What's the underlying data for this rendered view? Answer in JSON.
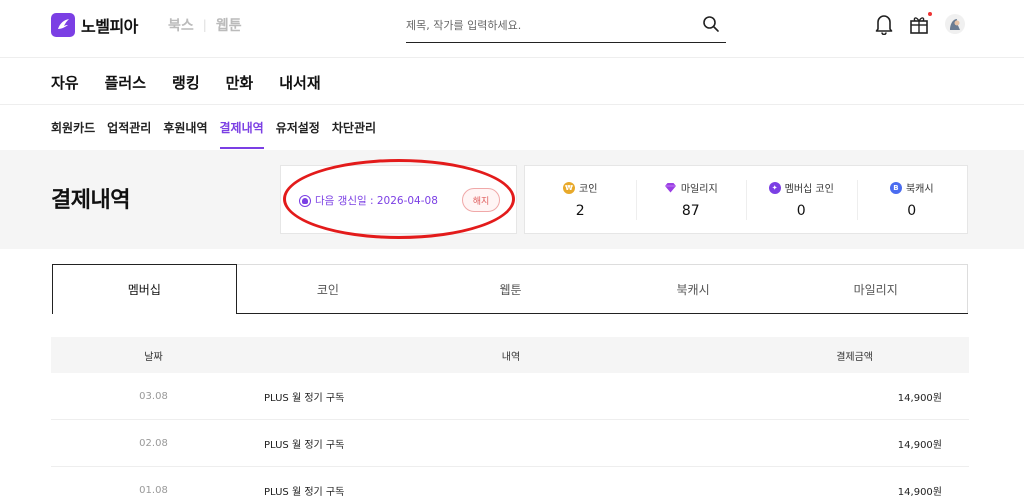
{
  "header": {
    "logo_text": "노벨피아",
    "brands": [
      "북스",
      "웹툰"
    ],
    "search_placeholder": "제목, 작가를 입력하세요."
  },
  "main_nav": [
    "자유",
    "플러스",
    "랭킹",
    "만화",
    "내서재"
  ],
  "sub_nav": {
    "items": [
      "회원카드",
      "업적관리",
      "후원내역",
      "결제내역",
      "유저설정",
      "차단관리"
    ],
    "active_index": 3
  },
  "page_title": "결제내역",
  "membership": {
    "renew_text": "다음 갱신일 : 2026-04-08",
    "cancel_label": "해지"
  },
  "balances": [
    {
      "icon": "coin-icon",
      "label": "코인",
      "value": "2"
    },
    {
      "icon": "gem-icon",
      "label": "마일리지",
      "value": "87"
    },
    {
      "icon": "membership-coin-icon",
      "label": "멤버십 코인",
      "value": "0"
    },
    {
      "icon": "bookcash-icon",
      "label": "북캐시",
      "value": "0"
    }
  ],
  "tabs": {
    "items": [
      "멤버십",
      "코인",
      "웹툰",
      "북캐시",
      "마일리지"
    ],
    "active_index": 0
  },
  "table": {
    "columns": [
      "날짜",
      "내역",
      "결제금액"
    ],
    "rows": [
      {
        "date": "03.08",
        "desc": "PLUS 월 정기 구독",
        "amount": "14,900원"
      },
      {
        "date": "02.08",
        "desc": "PLUS 월 정기 구독",
        "amount": "14,900원"
      },
      {
        "date": "01.08",
        "desc": "PLUS 월 정기 구독",
        "amount": "14,900원"
      }
    ]
  },
  "colors": {
    "accent": "#7b3fe4",
    "highlight_ellipse": "#e31b1b"
  }
}
